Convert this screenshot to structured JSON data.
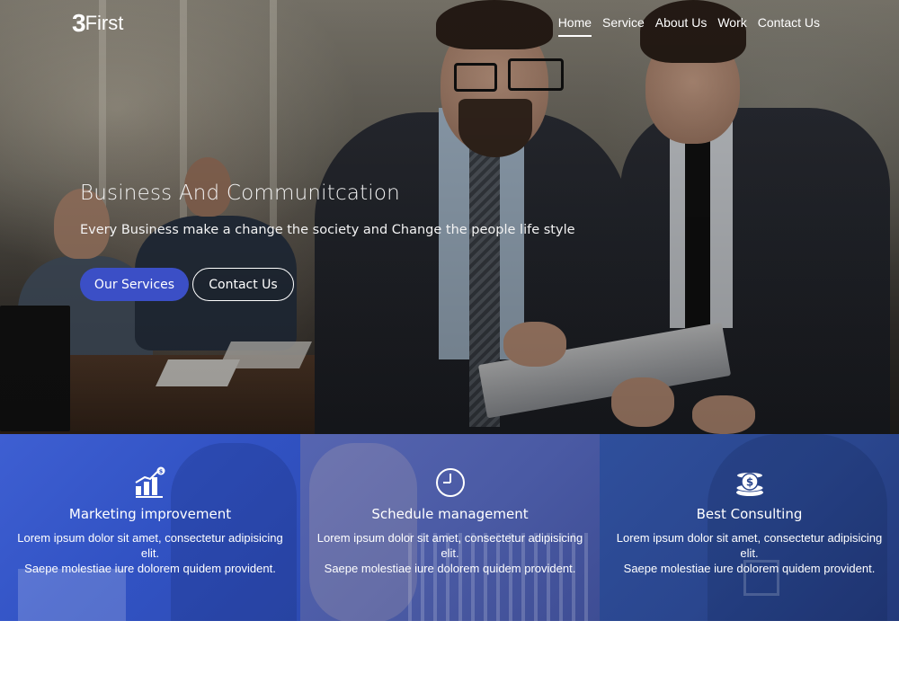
{
  "brand": {
    "logo_mark": "3",
    "logo_text": "First"
  },
  "nav": {
    "items": [
      {
        "label": "Home",
        "active": true
      },
      {
        "label": "Service",
        "active": false
      },
      {
        "label": "About Us",
        "active": false
      },
      {
        "label": "Work",
        "active": false
      },
      {
        "label": "Contact Us",
        "active": false
      }
    ]
  },
  "hero": {
    "title": "Business And Communitcation",
    "subtitle": "Every Business make a change the society and Change the people life style",
    "primary_button": "Our Services",
    "secondary_button": "Contact Us"
  },
  "features": [
    {
      "icon": "growth-chart-icon",
      "title": "Marketing improvement",
      "line1": "Lorem ipsum dolor sit amet, consectetur adipisicing elit.",
      "line2": "Saepe molestiae iure dolorem quidem provident."
    },
    {
      "icon": "clock-icon",
      "title": "Schedule management",
      "line1": "Lorem ipsum dolor sit amet, consectetur adipisicing elit.",
      "line2": "Saepe molestiae iure dolorem quidem provident."
    },
    {
      "icon": "coins-dollar-icon",
      "title": "Best Consulting",
      "line1": "Lorem ipsum dolor sit amet, consectetur adipisicing elit.",
      "line2": "Saepe molestiae iure dolorem quidem provident."
    }
  ],
  "colors": {
    "primary_button": "#3b4fc6",
    "feature1": "#3152c3",
    "feature2": "#4a5aa4",
    "feature3": "#2a468e"
  }
}
